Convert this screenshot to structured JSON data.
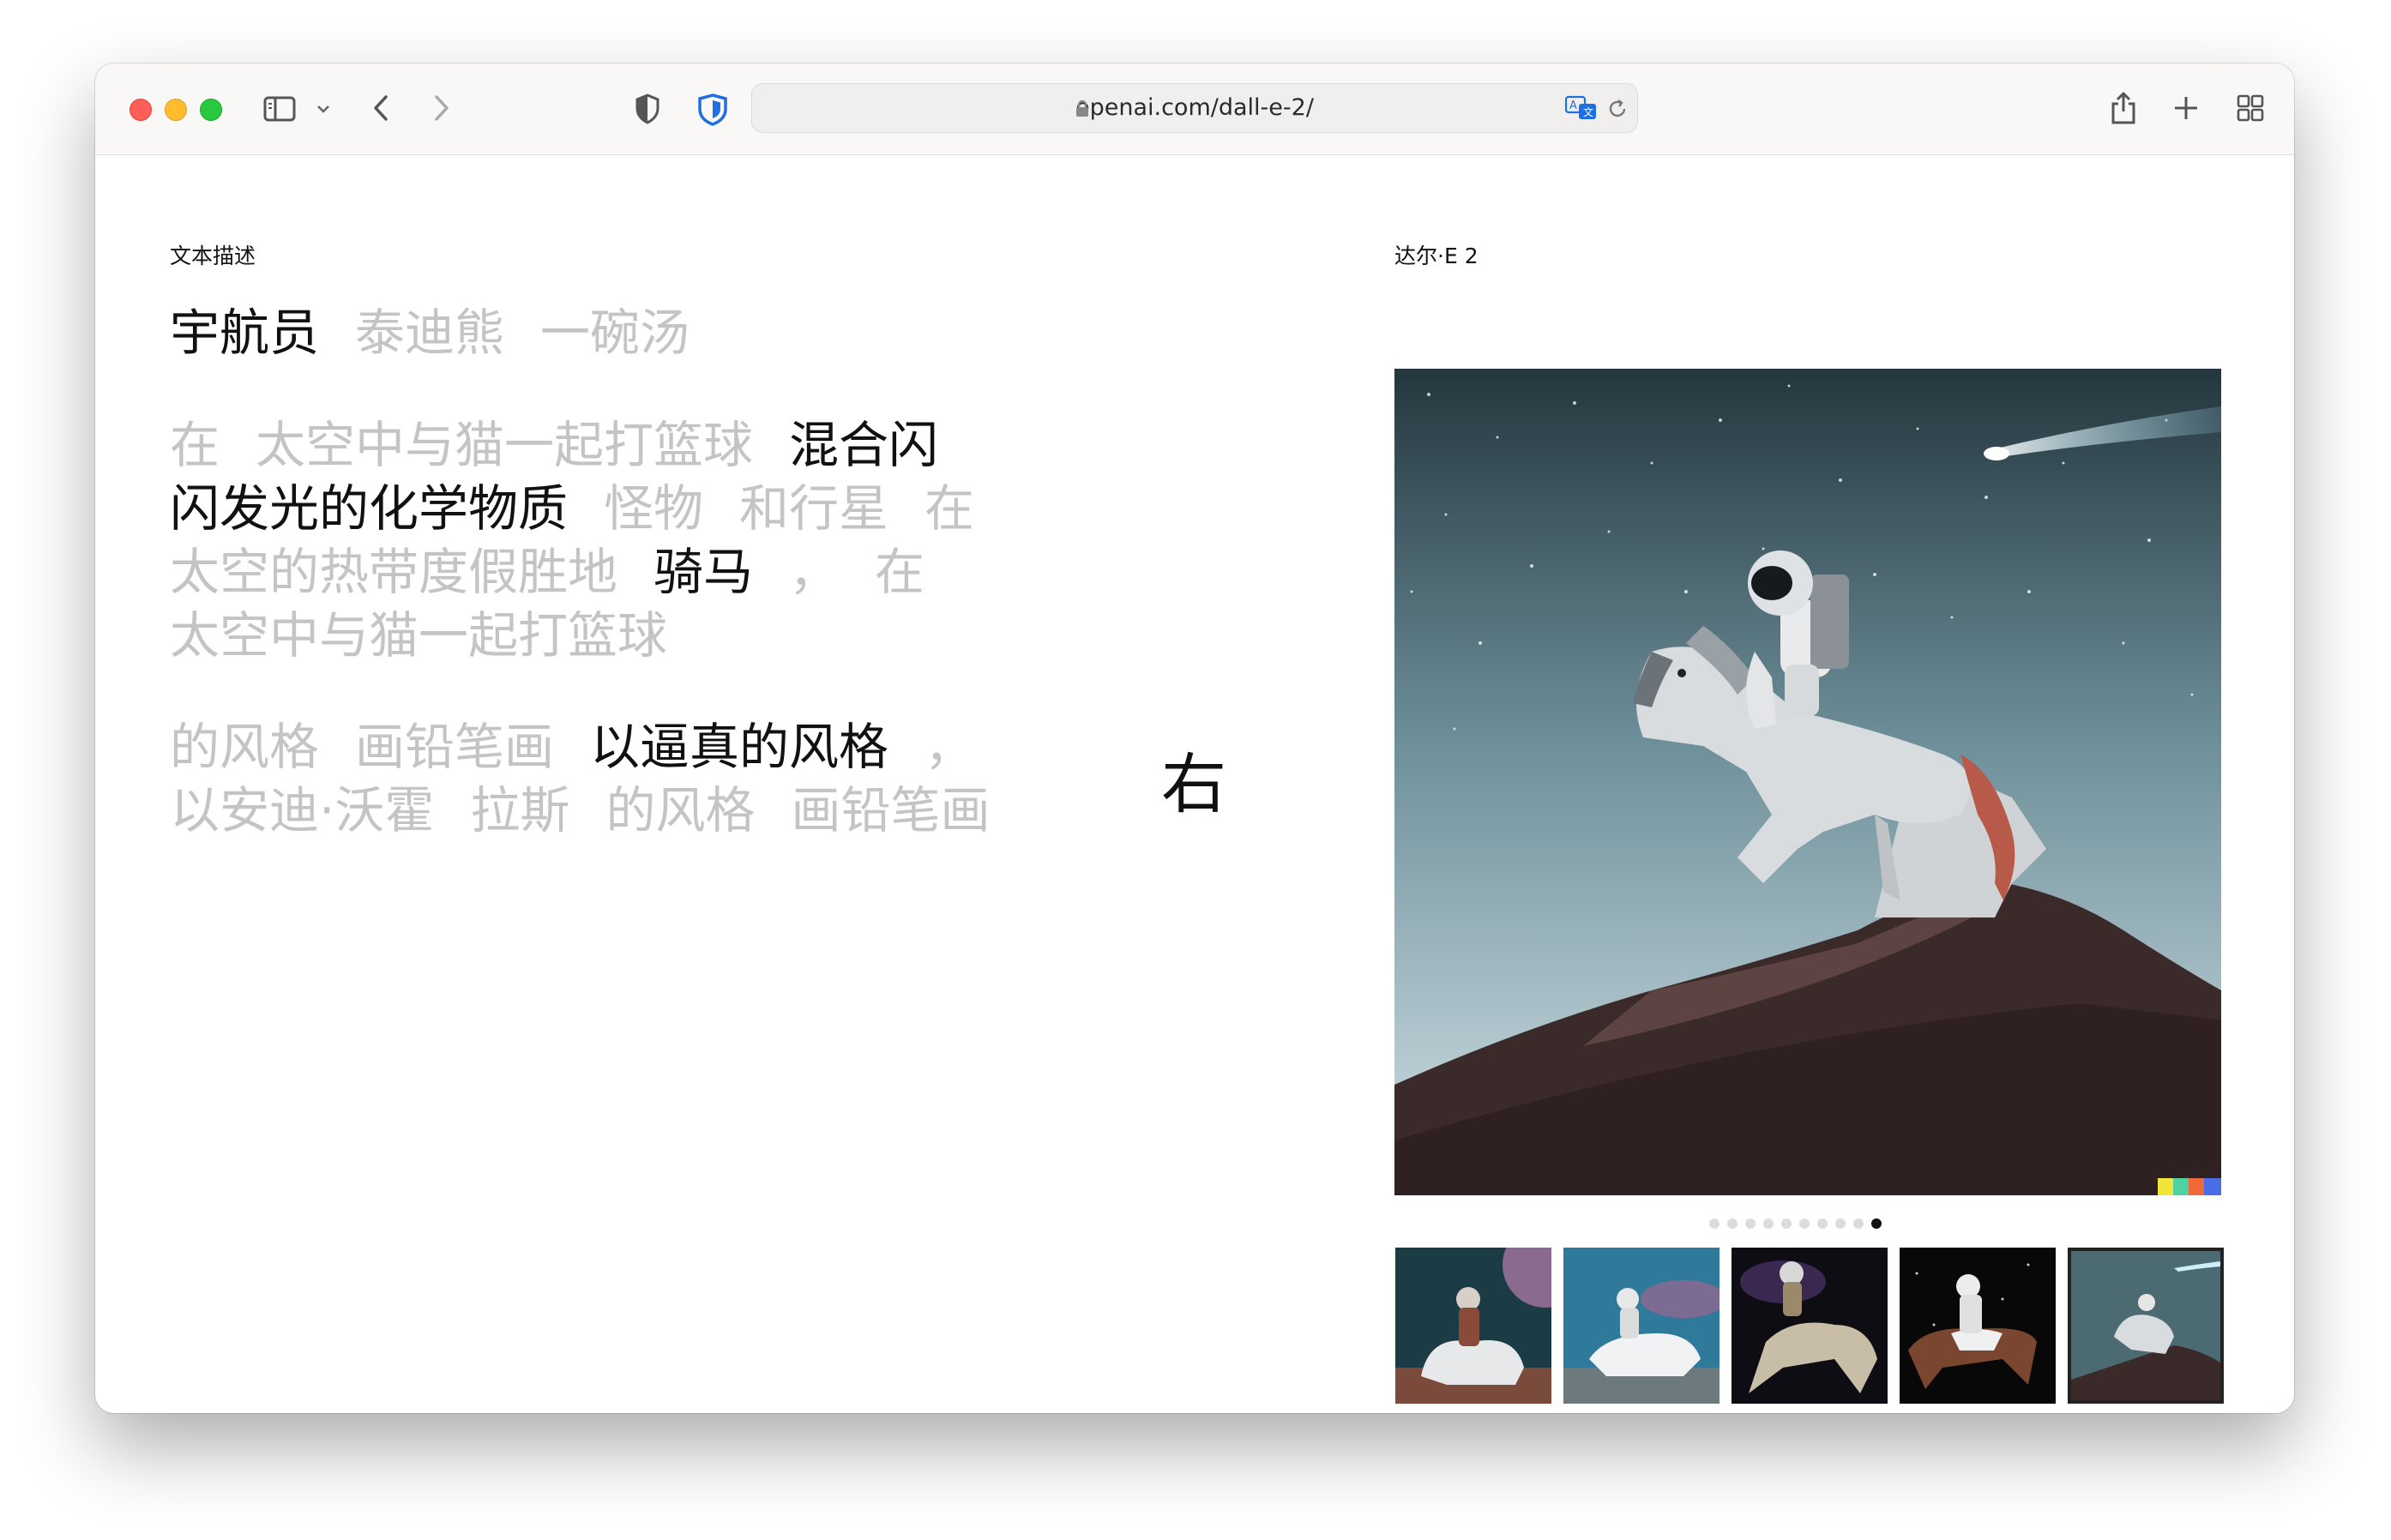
{
  "browser": {
    "url": "openai.com/dall-e-2/"
  },
  "page": {
    "left_label": "文本描述",
    "right_label": "达尔·E 2",
    "subject_options": [
      {
        "text": "宇航员",
        "active": true
      },
      {
        "text": "泰迪熊",
        "active": false
      },
      {
        "text": "一碗汤",
        "active": false
      }
    ],
    "action_lines": [
      [
        {
          "text": "在",
          "active": false
        },
        {
          "text": "太空中与猫一起打篮球",
          "active": false
        },
        {
          "text": "混合闪",
          "active": true
        }
      ],
      [
        {
          "text": "闪发光的化学物质",
          "active": true
        },
        {
          "text": "怪物",
          "active": false
        },
        {
          "text": "和行星",
          "active": false
        },
        {
          "text": "在",
          "active": false
        }
      ],
      [
        {
          "text": "太空的热带度假胜地",
          "active": false
        },
        {
          "text": "骑马",
          "active": true
        },
        {
          "text": "，",
          "active": false
        },
        {
          "text": "在",
          "active": false
        }
      ],
      [
        {
          "text": "太空中与猫一起打篮球",
          "active": false
        }
      ]
    ],
    "style_lines": [
      [
        {
          "text": "的风格",
          "active": false
        },
        {
          "text": "画铅笔画",
          "active": false
        },
        {
          "text": "以逼真的风格",
          "active": true
        },
        {
          "text": "，",
          "active": false
        }
      ],
      [
        {
          "text": "以安迪·沃霍",
          "active": false
        },
        {
          "text": "拉斯",
          "active": false
        },
        {
          "text": "的风格",
          "active": false
        },
        {
          "text": "画铅笔画",
          "active": false
        }
      ]
    ],
    "center_char": "右",
    "carousel": {
      "count": 10,
      "active_index": 9
    },
    "thumbnail_count": 5,
    "selected_thumbnail": 4
  },
  "colors": {
    "accent_shield": "#1f6fe0",
    "active_text": "#111111",
    "inactive_text": "#c4c4c4"
  }
}
